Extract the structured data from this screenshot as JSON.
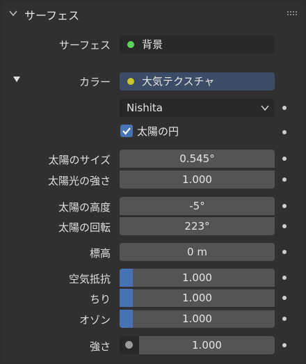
{
  "panel": {
    "title": "サーフェス"
  },
  "surface": {
    "label": "サーフェス",
    "value": "背景",
    "dot_color": "#5fcf5f"
  },
  "color": {
    "label": "カラー",
    "value": "大気テクスチャ",
    "dot_color": "#c7c729"
  },
  "sky_type": {
    "value": "Nishita"
  },
  "sun_disc": {
    "label": "太陽の円",
    "checked": true
  },
  "sun_size": {
    "label": "太陽のサイズ",
    "value": "0.545°"
  },
  "sun_intensity": {
    "label": "太陽光の強さ",
    "value": "1.000"
  },
  "sun_elevation": {
    "label": "太陽の高度",
    "value": "-5°"
  },
  "sun_rotation": {
    "label": "太陽の回転",
    "value": "223°"
  },
  "altitude": {
    "label": "標高",
    "value": "0 m"
  },
  "air": {
    "label": "空気抵抗",
    "value": "1.000"
  },
  "dust": {
    "label": "ちり",
    "value": "1.000"
  },
  "ozone": {
    "label": "オゾン",
    "value": "1.000"
  },
  "strength": {
    "label": "強さ",
    "value": "1.000"
  },
  "accent": "#4772b3"
}
